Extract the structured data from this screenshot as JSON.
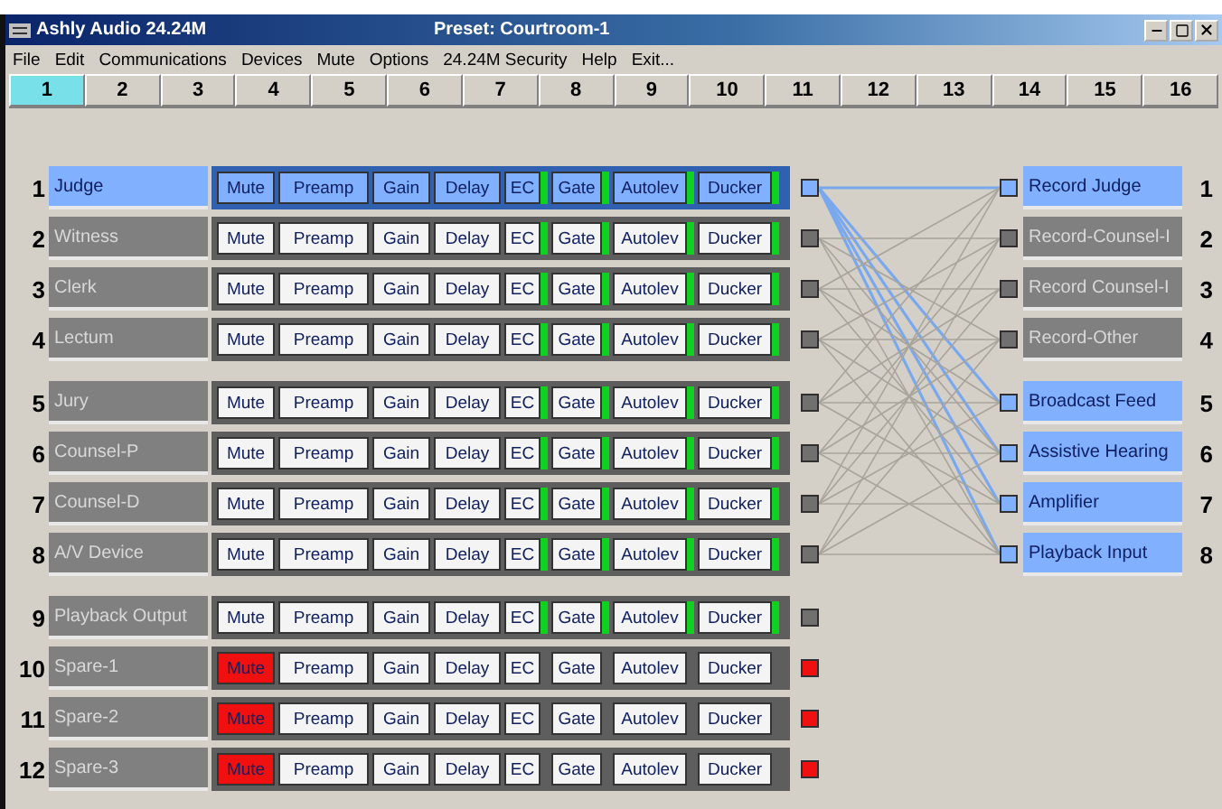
{
  "window": {
    "title": "Ashly Audio 24.24M",
    "preset": "Preset: Courtroom-1"
  },
  "menu": [
    "File",
    "Edit",
    "Communications",
    "Devices",
    "Mute",
    "Options",
    "24.24M Security",
    "Help",
    "Exit..."
  ],
  "tabs": [
    {
      "label": "1",
      "selected": true
    },
    {
      "label": "2",
      "selected": false
    },
    {
      "label": "3",
      "selected": false
    },
    {
      "label": "4",
      "selected": false
    },
    {
      "label": "5",
      "selected": false
    },
    {
      "label": "6",
      "selected": false
    },
    {
      "label": "7",
      "selected": false
    },
    {
      "label": "8",
      "selected": false
    },
    {
      "label": "9",
      "selected": false
    },
    {
      "label": "10",
      "selected": false
    },
    {
      "label": "11",
      "selected": false
    },
    {
      "label": "12",
      "selected": false
    },
    {
      "label": "13",
      "selected": false
    },
    {
      "label": "14",
      "selected": false
    },
    {
      "label": "15",
      "selected": false
    },
    {
      "label": "16",
      "selected": false
    }
  ],
  "inputs": [
    {
      "rows": [
        {
          "number": "1",
          "name": "Judge",
          "selected": true,
          "blocks": [
            {
              "label": "Mute",
              "kind": "toggle",
              "on": false
            },
            {
              "label": "Preamp",
              "kind": "plain"
            },
            {
              "label": "Gain",
              "kind": "plain"
            },
            {
              "label": "Delay",
              "kind": "plain"
            },
            {
              "label": "EC",
              "kind": "flag",
              "on": true
            },
            {
              "label": "Gate",
              "kind": "flag",
              "on": true
            },
            {
              "label": "Autolev",
              "kind": "flag",
              "on": true
            },
            {
              "label": "Ducker",
              "kind": "flag",
              "on": true
            }
          ]
        },
        {
          "number": "2",
          "name": "Witness",
          "selected": false,
          "blocks": [
            {
              "label": "Mute",
              "kind": "toggle",
              "on": false
            },
            {
              "label": "Preamp",
              "kind": "plain"
            },
            {
              "label": "Gain",
              "kind": "plain"
            },
            {
              "label": "Delay",
              "kind": "plain"
            },
            {
              "label": "EC",
              "kind": "flag",
              "on": true
            },
            {
              "label": "Gate",
              "kind": "flag",
              "on": true
            },
            {
              "label": "Autolev",
              "kind": "flag",
              "on": true
            },
            {
              "label": "Ducker",
              "kind": "flag",
              "on": true
            }
          ]
        },
        {
          "number": "3",
          "name": "Clerk",
          "selected": false,
          "blocks": [
            {
              "label": "Mute",
              "kind": "toggle",
              "on": false
            },
            {
              "label": "Preamp",
              "kind": "plain"
            },
            {
              "label": "Gain",
              "kind": "plain"
            },
            {
              "label": "Delay",
              "kind": "plain"
            },
            {
              "label": "EC",
              "kind": "flag",
              "on": true
            },
            {
              "label": "Gate",
              "kind": "flag",
              "on": true
            },
            {
              "label": "Autolev",
              "kind": "flag",
              "on": true
            },
            {
              "label": "Ducker",
              "kind": "flag",
              "on": true
            }
          ]
        },
        {
          "number": "4",
          "name": "Lectum",
          "selected": false,
          "blocks": [
            {
              "label": "Mute",
              "kind": "toggle",
              "on": false
            },
            {
              "label": "Preamp",
              "kind": "plain"
            },
            {
              "label": "Gain",
              "kind": "plain"
            },
            {
              "label": "Delay",
              "kind": "plain"
            },
            {
              "label": "EC",
              "kind": "flag",
              "on": true
            },
            {
              "label": "Gate",
              "kind": "flag",
              "on": true
            },
            {
              "label": "Autolev",
              "kind": "flag",
              "on": true
            },
            {
              "label": "Ducker",
              "kind": "flag",
              "on": true
            }
          ]
        }
      ]
    },
    {
      "rows": [
        {
          "number": "5",
          "name": "Jury",
          "selected": false,
          "blocks": [
            {
              "label": "Mute",
              "kind": "toggle",
              "on": false
            },
            {
              "label": "Preamp",
              "kind": "plain"
            },
            {
              "label": "Gain",
              "kind": "plain"
            },
            {
              "label": "Delay",
              "kind": "plain"
            },
            {
              "label": "EC",
              "kind": "flag",
              "on": true
            },
            {
              "label": "Gate",
              "kind": "flag",
              "on": true
            },
            {
              "label": "Autolev",
              "kind": "flag",
              "on": true
            },
            {
              "label": "Ducker",
              "kind": "flag",
              "on": true
            }
          ]
        },
        {
          "number": "6",
          "name": "Counsel-P",
          "selected": false,
          "blocks": [
            {
              "label": "Mute",
              "kind": "toggle",
              "on": false
            },
            {
              "label": "Preamp",
              "kind": "plain"
            },
            {
              "label": "Gain",
              "kind": "plain"
            },
            {
              "label": "Delay",
              "kind": "plain"
            },
            {
              "label": "EC",
              "kind": "flag",
              "on": true
            },
            {
              "label": "Gate",
              "kind": "flag",
              "on": true
            },
            {
              "label": "Autolev",
              "kind": "flag",
              "on": true
            },
            {
              "label": "Ducker",
              "kind": "flag",
              "on": true
            }
          ]
        },
        {
          "number": "7",
          "name": "Counsel-D",
          "selected": false,
          "blocks": [
            {
              "label": "Mute",
              "kind": "toggle",
              "on": false
            },
            {
              "label": "Preamp",
              "kind": "plain"
            },
            {
              "label": "Gain",
              "kind": "plain"
            },
            {
              "label": "Delay",
              "kind": "plain"
            },
            {
              "label": "EC",
              "kind": "flag",
              "on": true
            },
            {
              "label": "Gate",
              "kind": "flag",
              "on": true
            },
            {
              "label": "Autolev",
              "kind": "flag",
              "on": true
            },
            {
              "label": "Ducker",
              "kind": "flag",
              "on": true
            }
          ]
        },
        {
          "number": "8",
          "name": "A/V Device",
          "selected": false,
          "blocks": [
            {
              "label": "Mute",
              "kind": "toggle",
              "on": false
            },
            {
              "label": "Preamp",
              "kind": "plain"
            },
            {
              "label": "Gain",
              "kind": "plain"
            },
            {
              "label": "Delay",
              "kind": "plain"
            },
            {
              "label": "EC",
              "kind": "flag",
              "on": true
            },
            {
              "label": "Gate",
              "kind": "flag",
              "on": true
            },
            {
              "label": "Autolev",
              "kind": "flag",
              "on": true
            },
            {
              "label": "Ducker",
              "kind": "flag",
              "on": true
            }
          ]
        }
      ]
    },
    {
      "rows": [
        {
          "number": "9",
          "name": "Playback Output",
          "selected": false,
          "blocks": [
            {
              "label": "Mute",
              "kind": "toggle",
              "on": false
            },
            {
              "label": "Preamp",
              "kind": "plain"
            },
            {
              "label": "Gain",
              "kind": "plain"
            },
            {
              "label": "Delay",
              "kind": "plain"
            },
            {
              "label": "EC",
              "kind": "flag",
              "on": true
            },
            {
              "label": "Gate",
              "kind": "flag",
              "on": true
            },
            {
              "label": "Autolev",
              "kind": "flag",
              "on": true
            },
            {
              "label": "Ducker",
              "kind": "flag",
              "on": true
            }
          ]
        },
        {
          "number": "10",
          "name": "Spare-1",
          "selected": false,
          "blocks": [
            {
              "label": "Mute",
              "kind": "toggle",
              "on": true
            },
            {
              "label": "Preamp",
              "kind": "plain"
            },
            {
              "label": "Gain",
              "kind": "plain"
            },
            {
              "label": "Delay",
              "kind": "plain"
            },
            {
              "label": "EC",
              "kind": "flag",
              "on": false
            },
            {
              "label": "Gate",
              "kind": "flag",
              "on": false
            },
            {
              "label": "Autolev",
              "kind": "flag",
              "on": false
            },
            {
              "label": "Ducker",
              "kind": "flag",
              "on": false
            }
          ]
        },
        {
          "number": "11",
          "name": "Spare-2",
          "selected": false,
          "blocks": [
            {
              "label": "Mute",
              "kind": "toggle",
              "on": true
            },
            {
              "label": "Preamp",
              "kind": "plain"
            },
            {
              "label": "Gain",
              "kind": "plain"
            },
            {
              "label": "Delay",
              "kind": "plain"
            },
            {
              "label": "EC",
              "kind": "flag",
              "on": false
            },
            {
              "label": "Gate",
              "kind": "flag",
              "on": false
            },
            {
              "label": "Autolev",
              "kind": "flag",
              "on": false
            },
            {
              "label": "Ducker",
              "kind": "flag",
              "on": false
            }
          ]
        },
        {
          "number": "12",
          "name": "Spare-3",
          "selected": false,
          "blocks": [
            {
              "label": "Mute",
              "kind": "toggle",
              "on": true
            },
            {
              "label": "Preamp",
              "kind": "plain"
            },
            {
              "label": "Gain",
              "kind": "plain"
            },
            {
              "label": "Delay",
              "kind": "plain"
            },
            {
              "label": "EC",
              "kind": "flag",
              "on": false
            },
            {
              "label": "Gate",
              "kind": "flag",
              "on": false
            },
            {
              "label": "Autolev",
              "kind": "flag",
              "on": false
            },
            {
              "label": "Ducker",
              "kind": "flag",
              "on": false
            }
          ]
        }
      ]
    }
  ],
  "outputs": [
    {
      "rows": [
        {
          "number": "1",
          "name": "Record Judge",
          "selected": true
        },
        {
          "number": "2",
          "name": "Record-Counsel-I",
          "selected": false
        },
        {
          "number": "3",
          "name": "Record Counsel-I",
          "selected": false
        },
        {
          "number": "4",
          "name": "Record-Other",
          "selected": false
        }
      ]
    },
    {
      "rows": [
        {
          "number": "5",
          "name": "Broadcast Feed",
          "selected": true
        },
        {
          "number": "6",
          "name": "Assistive Hearing",
          "selected": true
        },
        {
          "number": "7",
          "name": "Amplifier",
          "selected": true
        },
        {
          "number": "8",
          "name": "Playback Input",
          "selected": true
        }
      ]
    }
  ]
}
